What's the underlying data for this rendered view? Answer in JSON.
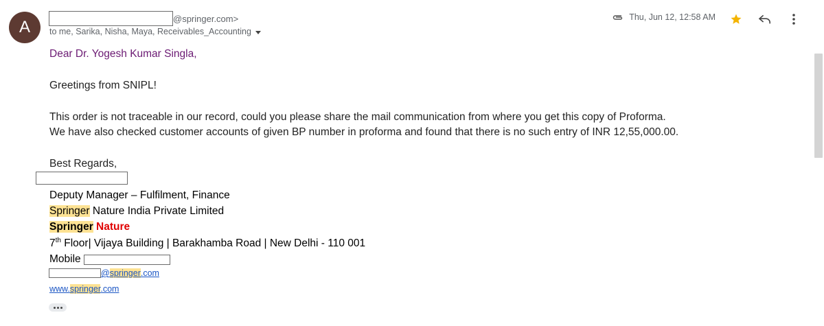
{
  "header": {
    "avatar_letter": "A",
    "avatar_color": "#5d3a32",
    "sender_suffix": "@springer.com>",
    "recipients": "to me, Sarika, Nisha, Maya, Receivables_Accounting",
    "timestamp": "Thu, Jun 12, 12:58 AM",
    "icons": [
      "paperclip-icon",
      "star-icon",
      "reply-icon",
      "more-vert-icon",
      "chevron-down-icon"
    ],
    "star_color": "#f4b400"
  },
  "body": {
    "salutation": "Dear Dr. Yogesh Kumar Singla,",
    "greeting": "Greetings from SNIPL!",
    "paragraph_line1": "This order is not traceable in our record, could you please share the mail communication from where you get this copy of Proforma.",
    "paragraph_line2": "We have also checked customer accounts of given BP number in proforma and found that there is no such entry of INR 12,55,000.00.",
    "closing": "Best Regards,"
  },
  "signature": {
    "title": "Deputy Manager – Fulfilment, Finance",
    "company_hl": "Springer",
    "company_rest": " Nature India Private Limited",
    "brand_hl": "Springer",
    "brand_red": " Nature",
    "address_prefix": "7",
    "address_sup": "th",
    "address_rest": " Floor| Vijaya Building | Barakhamba Road | New Delhi - 110 001",
    "mobile_label": "Mobile",
    "email_at": "@",
    "email_hl": "springer",
    "email_tld": ".com",
    "web_prefix": "www.",
    "web_hl": "springer",
    "web_tld": ".com"
  },
  "colors": {
    "highlight": "#fde293",
    "brand_red": "#e00000",
    "link": "#1a55c4",
    "salutation": "#6b1a73"
  }
}
